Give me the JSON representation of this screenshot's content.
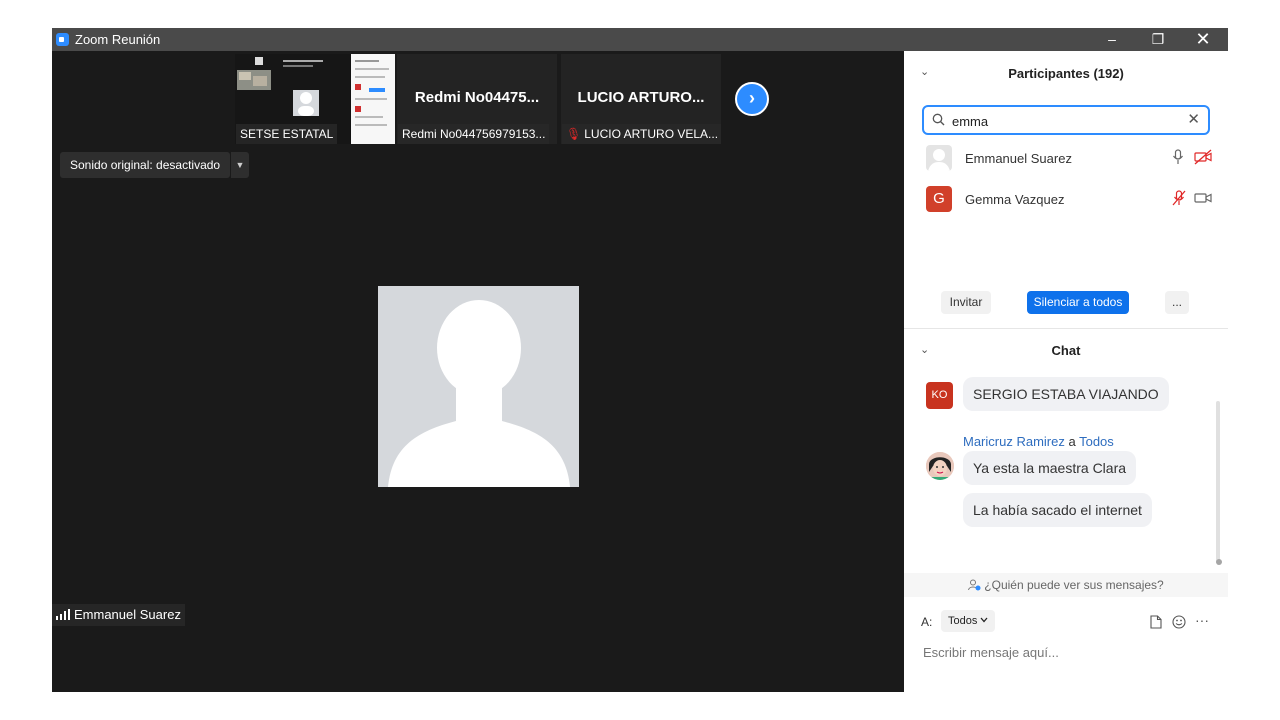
{
  "window": {
    "title": "Zoom Reunión",
    "minimize": "–",
    "maximize": "❐",
    "close": "✕"
  },
  "video": {
    "thumbnails": [
      {
        "label": "SETSE ESTATAL",
        "big": ""
      },
      {
        "label": "Redmi No044756979153...",
        "big": "Redmi No04475..."
      },
      {
        "label": "LUCIO ARTURO VELA...",
        "big": "LUCIO ARTURO..."
      }
    ],
    "next": "›",
    "sound_original": "Sonido original: desactivado",
    "sound_dropdown": "▼",
    "speaker_name": "Emmanuel Suarez"
  },
  "participants": {
    "title": "Participantes (192)",
    "collapse": "⌄",
    "search_value": "emma",
    "search_clear": "✕",
    "list": [
      {
        "name": "Emmanuel Suarez",
        "initial": ""
      },
      {
        "name": "Gemma Vazquez",
        "initial": "G"
      }
    ],
    "invite": "Invitar",
    "mute_all": "Silenciar a todos",
    "more": "..."
  },
  "chat": {
    "title": "Chat",
    "collapse": "⌄",
    "ko_initials": "KO",
    "msg1": "SERGIO ESTABA  VIAJANDO",
    "sender_name": "Maricruz Ramirez",
    "sender_to_word": "a",
    "sender_target": "Todos",
    "msg2": "Ya esta la maestra Clara",
    "msg3": "La había sacado el internet",
    "who_can_see": "¿Quién puede ver sus mensajes?",
    "to_label": "A:",
    "to_value": "Todos",
    "more": "···",
    "input_placeholder": "Escribir mensaje aquí..."
  },
  "colors": {
    "accent": "#2d8cff",
    "button_blue": "#0e71eb",
    "muted_red": "#e02828",
    "video_bg": "#1a1a1a"
  }
}
